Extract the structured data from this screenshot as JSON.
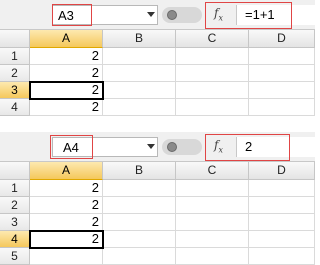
{
  "panels": [
    {
      "name_box": "A3",
      "formula": "=1+1",
      "columns": [
        "A",
        "B",
        "C",
        "D"
      ],
      "rows": [
        {
          "header": "1",
          "a": "2"
        },
        {
          "header": "2",
          "a": "2"
        },
        {
          "header": "3",
          "a": "2"
        },
        {
          "header": "4",
          "a": "2"
        }
      ],
      "active_row": 3,
      "active_column": "A"
    },
    {
      "name_box": "A4",
      "formula": "2",
      "columns": [
        "A",
        "B",
        "C",
        "D"
      ],
      "rows": [
        {
          "header": "1",
          "a": "2"
        },
        {
          "header": "2",
          "a": "2"
        },
        {
          "header": "3",
          "a": "2"
        },
        {
          "header": "4",
          "a": "2"
        },
        {
          "header": "5",
          "a": ""
        }
      ],
      "active_row": 4,
      "active_column": "A"
    }
  ],
  "icons": {
    "function": "fx-icon",
    "dropdown": "chevron-down-icon"
  },
  "colors": {
    "highlight": "#e04545",
    "selected_header": "#f5c85c",
    "grid_line": "#dadada",
    "header_bg": "#e4e4e4"
  }
}
